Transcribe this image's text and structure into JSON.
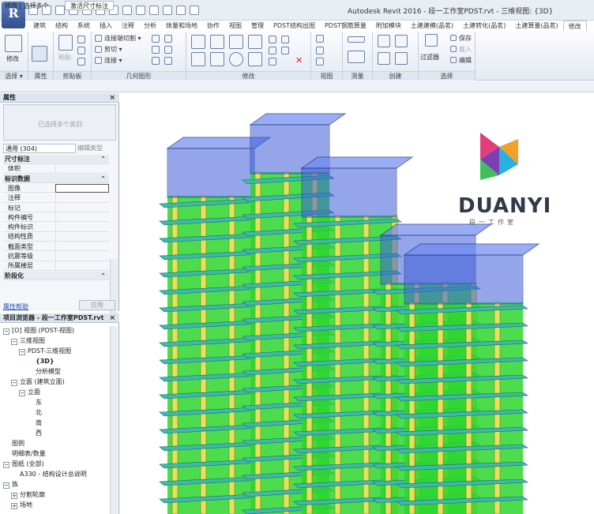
{
  "app": {
    "title": "Autodesk Revit 2016 -    段一工作室PDST.rvt - 三维视图: {3D}",
    "app_button": "R"
  },
  "tabs": [
    "建筑",
    "结构",
    "系统",
    "插入",
    "注释",
    "分析",
    "体量和场地",
    "协作",
    "视图",
    "管理",
    "PDST结构出图",
    "PDST钢筋算量",
    "附加模块",
    "土建建模(品茗)",
    "土建转化(品茗)",
    "土建算量(品茗)",
    "修改"
  ],
  "ribbon": {
    "select": {
      "label": "选择 ▾",
      "tool": "修改"
    },
    "properties": {
      "label": "属性"
    },
    "clipboard": {
      "label": "剪贴板",
      "paste": "粘贴"
    },
    "geometry": {
      "label": "几何图形",
      "items": [
        "连接端切割 ▾",
        "剪切 ▾",
        "连接 ▾"
      ]
    },
    "modify": {
      "label": "修改"
    },
    "view": {
      "label": "视图"
    },
    "measure": {
      "label": "测量"
    },
    "create": {
      "label": "创建"
    },
    "selection": {
      "label": "选择",
      "filter": "过滤器",
      "items": [
        "保存",
        "载入",
        "编辑"
      ]
    }
  },
  "context": {
    "label": "修改 | 选择多个",
    "active_tab": "激活尺寸标注"
  },
  "properties": {
    "header": "属性",
    "close": "×",
    "type_placeholder": "已选择多个类别",
    "type_selector": "通用 (304)",
    "edit_type": "编辑类型",
    "groups": [
      {
        "name": "尺寸标注",
        "rows": [
          "体积"
        ]
      },
      {
        "name": "标识数据",
        "rows": [
          "图像",
          "注释",
          "标记",
          "构件编号",
          "构件标识",
          "结构性质",
          "截面类型",
          "抗震等级",
          "所属楼层"
        ]
      },
      {
        "name": "阶段化",
        "rows": []
      }
    ],
    "help_link": "属性帮助",
    "apply": "应用"
  },
  "browser": {
    "header": "项目浏览器 - 段一工作室PDST.rvt",
    "close": "×",
    "items": [
      {
        "text": "[O] 视图 (PDST-视图)",
        "level": 0,
        "toggle": "−",
        "bold": false
      },
      {
        "text": "三维视图",
        "level": 1,
        "toggle": "−",
        "bold": false
      },
      {
        "text": "PDST-三维视图",
        "level": 2,
        "toggle": "−",
        "bold": false
      },
      {
        "text": "{3D}",
        "level": 3,
        "toggle": "",
        "bold": true
      },
      {
        "text": "分析模型",
        "level": 3,
        "toggle": "",
        "bold": false
      },
      {
        "text": "立面 (建筑立面)",
        "level": 1,
        "toggle": "−",
        "bold": false
      },
      {
        "text": "立面",
        "level": 2,
        "toggle": "−",
        "bold": false
      },
      {
        "text": "东",
        "level": 3,
        "toggle": "",
        "bold": false
      },
      {
        "text": "北",
        "level": 3,
        "toggle": "",
        "bold": false
      },
      {
        "text": "南",
        "level": 3,
        "toggle": "",
        "bold": false
      },
      {
        "text": "西",
        "level": 3,
        "toggle": "",
        "bold": false
      },
      {
        "text": "图例",
        "level": 0,
        "toggle": "",
        "bold": false
      },
      {
        "text": "明细表/数量",
        "level": 0,
        "toggle": "",
        "bold": false
      },
      {
        "text": "图纸 (全部)",
        "level": 0,
        "toggle": "−",
        "bold": false
      },
      {
        "text": "A330 - 结构设计总说明",
        "level": 1,
        "toggle": "",
        "bold": false
      },
      {
        "text": "族",
        "level": 0,
        "toggle": "−",
        "bold": false
      },
      {
        "text": "分割轮廓",
        "level": 1,
        "toggle": "+",
        "bold": false
      },
      {
        "text": "场地",
        "level": 1,
        "toggle": "+",
        "bold": false
      }
    ]
  },
  "logo": {
    "name": "DUANYI",
    "tagline": "段一工作室"
  },
  "colors": {
    "top_floors": "#3d5fd8",
    "columns": "#e8e05a",
    "walls": "#2dd62d",
    "slabs": "#3fb8a8"
  }
}
